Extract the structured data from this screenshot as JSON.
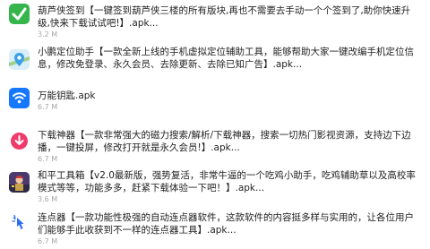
{
  "items": [
    {
      "title": "葫芦侠签到【一键签到葫芦侠三楼的所有版块,再也不需要去手动一个个签到了,助你快速升级,快来下载试试吧!】.apk...",
      "size": "3.2 M",
      "icon": "green-check-icon",
      "icon_color": "#2fb34a"
    },
    {
      "title": "小鹏定位助手【一款全新上线的手机虚拟定位辅助工具，能够帮助大家一键改编手机定位信息，修改免登录、永久会员、去除更新、去除已知广告】.apk...",
      "size": "",
      "icon": "map-pin-icon",
      "icon_color": "#3aa0e8"
    },
    {
      "title": "万能钥匙.apk",
      "size": "6.7 M",
      "icon": "wifi-key-icon",
      "icon_color": "#1677ff"
    },
    {
      "title": "下载神器【一款非常强大的磁力搜索/解析/下载神器，搜索一切热门影视资源，支持边下边播，一键投屏，修改打开就是永久会员!】.apk...",
      "size": "6.7 M",
      "icon": "download-arrow-icon",
      "icon_color": "#ef3b6b"
    },
    {
      "title": "和平工具箱【v2.0最新版，强势复活，非常牛逼的一个吃鸡小助手，吃鸡辅助草以及高校率模式等等，功能多多，赶紧下载体验一下吧！】.apk...",
      "size": "3.6 M",
      "icon": "game-character-icon",
      "icon_color": "#5a3a7a"
    },
    {
      "title": "连点器【一款功能性极强的自动连点器软件，这款软件的内容挺多样与实用的，让各位用户们能够手此收获到不一样的连点器工具】.apk...",
      "size": "6.7 M",
      "icon": "auto-clicker-icon",
      "icon_color": "#2d6cf0"
    }
  ]
}
